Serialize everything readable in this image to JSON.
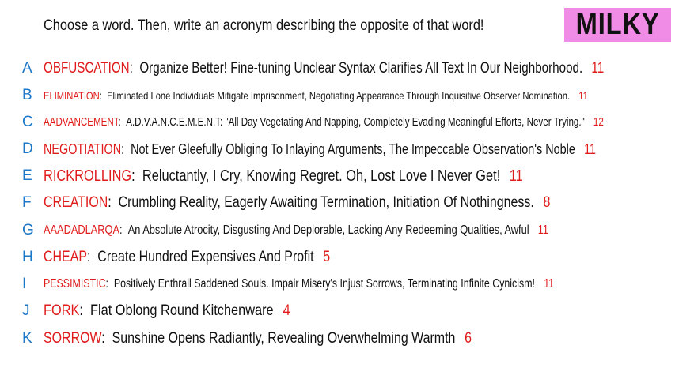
{
  "prompt": "Choose a word. Then, write an acronym describing the opposite of that word!",
  "badge": "MILKY",
  "colors": {
    "letter": "#1e78c8",
    "word": "#e01b1b",
    "badge_bg": "#f08ce6"
  },
  "rows": [
    {
      "letter": "A",
      "word": "OBFUSCATION",
      "desc": "Organize Better! Fine-tuning Unclear Syntax Clarifies All Text In Our Neighborhood.",
      "count": "11"
    },
    {
      "letter": "B",
      "word": "ELIMINATION",
      "desc": "Eliminated Lone Individuals Mitigate Imprisonment, Negotiating Appearance Through Inquisitive Observer Nomination.",
      "count": "11"
    },
    {
      "letter": "C",
      "word": "AADVANCEMENT",
      "desc": "A.D.V.A.N.C.E.M.E.N.T: \"All Day Vegetating And Napping, Completely Evading Meaningful Efforts, Never Trying.\"",
      "count": "12"
    },
    {
      "letter": "D",
      "word": "NEGOTIATION",
      "desc": "Not Ever Gleefully Obliging To Inlaying Arguments, The Impeccable Observation's Noble",
      "count": "11"
    },
    {
      "letter": "E",
      "word": "RICKROLLING",
      "desc": "Reluctantly, I Cry, Knowing Regret. Oh, Lost Love I Never Get!",
      "count": "11"
    },
    {
      "letter": "F",
      "word": "CREATION",
      "desc": "Crumbling Reality, Eagerly Awaiting Termination, Initiation Of Nothingness.",
      "count": "8"
    },
    {
      "letter": "G",
      "word": "AAADADLARQA",
      "desc": "An Absolute Atrocity, Disgusting And Deplorable, Lacking Any Redeeming Qualities, Awful",
      "count": "11"
    },
    {
      "letter": "H",
      "word": "CHEAP",
      "desc": "Create Hundred Expensives And Profit",
      "count": "5"
    },
    {
      "letter": "I",
      "word": "PESSIMISTIC",
      "desc": "Positively Enthrall Saddened Souls. Impair Misery's Injust Sorrows, Terminating Infinite Cynicism!",
      "count": "11"
    },
    {
      "letter": "J",
      "word": "FORK",
      "desc": "Flat Oblong Round Kitchenware",
      "count": "4"
    },
    {
      "letter": "K",
      "word": "SORROW",
      "desc": "Sunshine Opens Radiantly, Revealing Overwhelming Warmth",
      "count": "6"
    }
  ]
}
